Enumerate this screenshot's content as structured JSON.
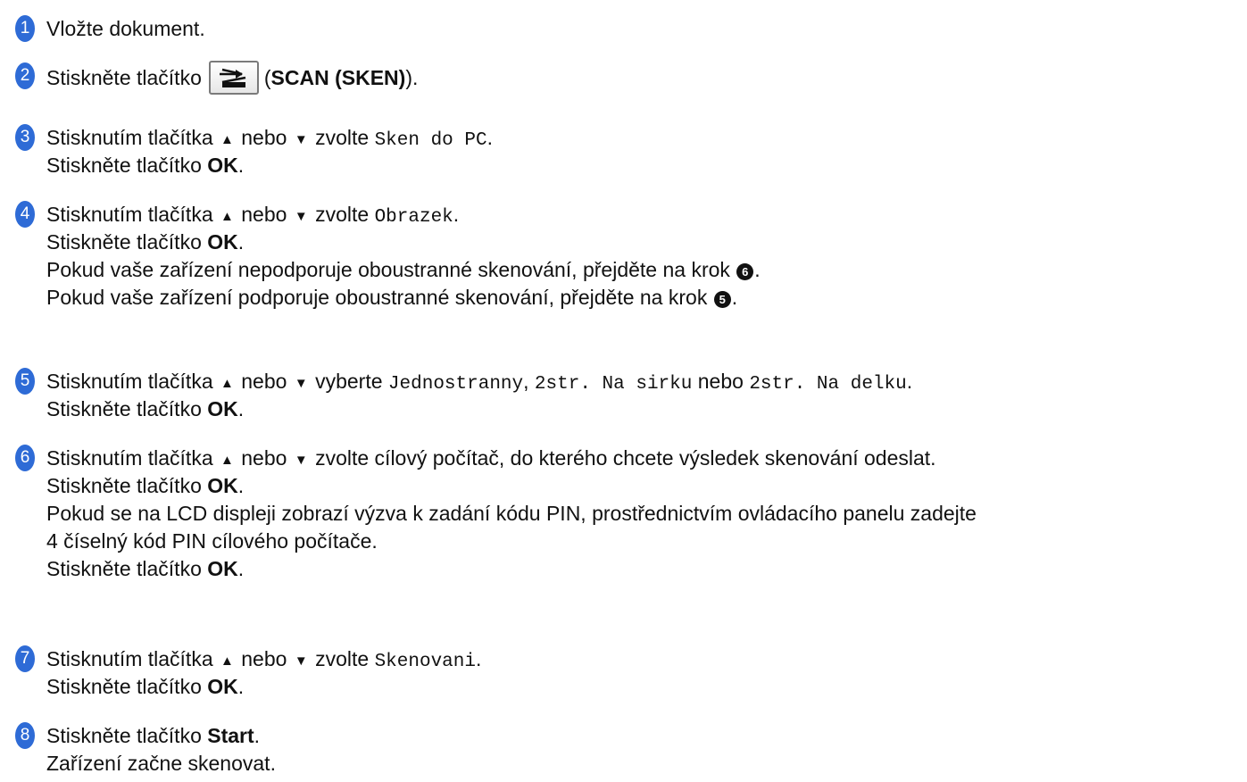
{
  "steps": [
    {
      "num": "1",
      "text": "Vložte dokument."
    },
    {
      "num": "2",
      "pre": "Stiskněte tlačítko",
      "open": "(",
      "bold": "SCAN (SKEN)",
      "close": ")."
    },
    {
      "num": "3",
      "pre": "Stisknutím tlačítka",
      "up": "▲",
      "mid": "nebo",
      "down": "▼",
      "post": "zvolte",
      "mono": "Sken do PC",
      "end": ".",
      "l2a": "Stiskněte tlačítko ",
      "l2b": "OK",
      "l2c": "."
    },
    {
      "num": "4",
      "pre": "Stisknutím tlačítka",
      "up": "▲",
      "mid": "nebo",
      "down": "▼",
      "post": "zvolte",
      "mono": "Obrazek",
      "end": ".",
      "l2a": "Stiskněte tlačítko ",
      "l2b": "OK",
      "l2c": ".",
      "l3a": "Pokud vaše zařízení nepodporuje oboustranné skenování, přejděte na krok ",
      "l3ref": "6",
      "l3c": ".",
      "l4a": "Pokud vaše zařízení podporuje oboustranné skenování, přejděte na krok ",
      "l4ref": "5",
      "l4c": "."
    },
    {
      "num": "5",
      "pre": "Stisknutím tlačítka",
      "up": "▲",
      "mid": "nebo",
      "down": "▼",
      "post": "vyberte",
      "mono1": "Jednostranny",
      "sep": ",",
      "mono2": "2str. Na sirku",
      "or": "nebo",
      "mono3": "2str. Na delku",
      "end": ".",
      "l2a": "Stiskněte tlačítko ",
      "l2b": "OK",
      "l2c": "."
    },
    {
      "num": "6",
      "pre": "Stisknutím tlačítka",
      "up": "▲",
      "mid": "nebo",
      "down": "▼",
      "post": "zvolte cílový počítač, do kterého chcete výsledek skenování odeslat.",
      "l2a": "Stiskněte tlačítko ",
      "l2b": "OK",
      "l2c": ".",
      "l3": "Pokud se na LCD displeji zobrazí výzva k zadání kódu PIN, prostřednictvím ovládacího panelu zadejte",
      "l4": "4 číselný kód PIN cílového počítače.",
      "l5a": "Stiskněte tlačítko ",
      "l5b": "OK",
      "l5c": "."
    },
    {
      "num": "7",
      "pre": "Stisknutím tlačítka",
      "up": "▲",
      "mid": "nebo",
      "down": "▼",
      "post": "zvolte",
      "mono": "Skenovani",
      "end": ".",
      "l2a": "Stiskněte tlačítko ",
      "l2b": "OK",
      "l2c": "."
    },
    {
      "num": "8",
      "pre": "Stiskněte tlačítko ",
      "bold": "Start",
      "end": ".",
      "l2": "Zařízení začne skenovat."
    }
  ],
  "icons": {
    "scan_button": "scan-key-icon"
  },
  "colors": {
    "step_badge": "#2e6bd6"
  }
}
